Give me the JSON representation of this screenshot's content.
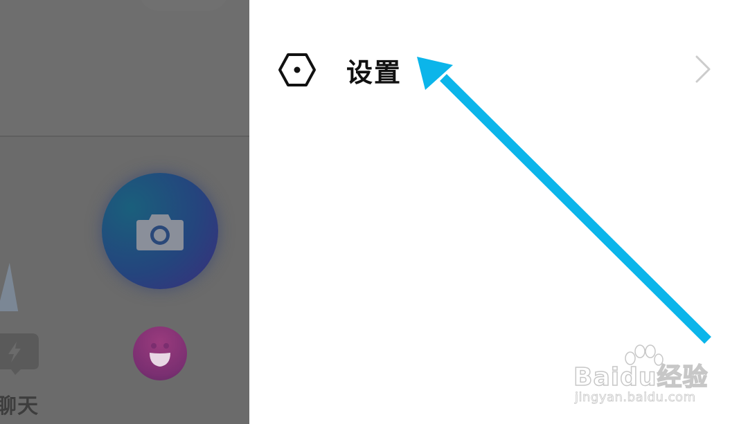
{
  "left_panel": {
    "chat_label": "聊天",
    "icons": [
      "camera-icon",
      "sticker-face-icon",
      "chat-bolt-icon"
    ]
  },
  "drawer": {
    "settings": {
      "label": "设置",
      "icon": "settings-hexagon-icon",
      "chevron": "chevron-right-icon"
    }
  },
  "annotation": {
    "arrow_color": "#0bb5ea"
  },
  "watermark": {
    "brand": "Baidu经验",
    "url": "jingyan.baidu.com"
  },
  "colors": {
    "overlay": "#6b6b6b",
    "drawer_bg": "#ffffff",
    "label": "#111111",
    "chevron": "#cccccc"
  }
}
